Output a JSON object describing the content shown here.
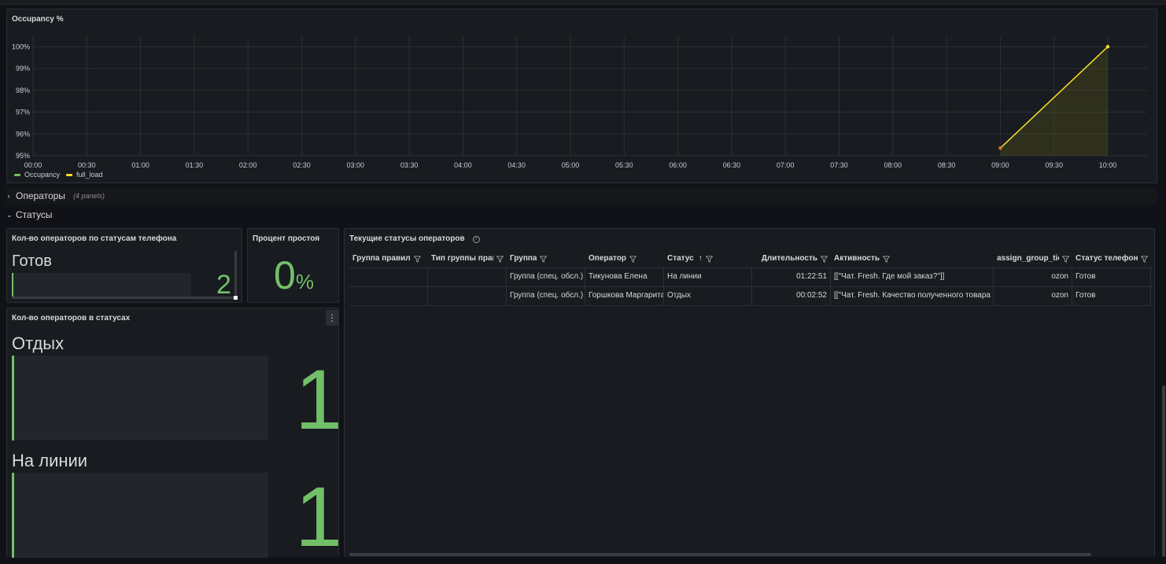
{
  "chart_panel": {
    "title": "Occupancy %",
    "legend": [
      {
        "name": "Occupancy",
        "color": "#73bf69"
      },
      {
        "name": "full_load",
        "color": "#fade2a"
      }
    ]
  },
  "chart_data": {
    "type": "line",
    "title": "Occupancy %",
    "x": [
      "00:00",
      "00:30",
      "01:00",
      "01:30",
      "02:00",
      "02:30",
      "03:00",
      "03:30",
      "04:00",
      "04:30",
      "05:00",
      "05:30",
      "06:00",
      "06:30",
      "07:00",
      "07:30",
      "08:00",
      "08:30",
      "09:00",
      "09:30",
      "10:00"
    ],
    "y_ticks": [
      "95%",
      "96%",
      "97%",
      "98%",
      "99%",
      "100%"
    ],
    "ylim": [
      95,
      100.05
    ],
    "grid": true,
    "legend_placement": "bottom-left",
    "series": [
      {
        "name": "full_load",
        "color": "#fade2a",
        "points": [
          {
            "x": "09:00",
            "y": 95.35
          },
          {
            "x": "10:00",
            "y": 100
          }
        ]
      }
    ]
  },
  "rows": {
    "operators": {
      "title": "Операторы",
      "subtitle": "(4 panels)",
      "chevron": "›"
    },
    "statuses": {
      "title": "Статусы",
      "chevron": "⌄"
    }
  },
  "phone_panel": {
    "title": "Кол-во операторов по статусам телефона",
    "items": [
      {
        "label": "Готов",
        "value": "2",
        "fill": 0.01
      }
    ]
  },
  "idle_panel": {
    "title": "Процент простоя",
    "value": "0",
    "unit": "%"
  },
  "status_panel": {
    "title": "Кол-во операторов в статусах",
    "menu": "⋮",
    "items": [
      {
        "label": "Отдых",
        "value": "1",
        "fill": 0.01
      },
      {
        "label": "На линии",
        "value": "1",
        "fill": 0.01
      }
    ]
  },
  "table_panel": {
    "title": "Текущие статусы операторов",
    "info": "i",
    "columns": [
      {
        "label": "Группа правил",
        "filter": true
      },
      {
        "label": "Тип группы прав",
        "filter": true
      },
      {
        "label": "Группа",
        "filter": true
      },
      {
        "label": "Оператор",
        "filter": true
      },
      {
        "label": "Статус",
        "sort": "↑",
        "filter": true
      },
      {
        "label": "Длительность",
        "filter": true
      },
      {
        "label": "Активность",
        "filter": true
      },
      {
        "label": "assign_group_ticl",
        "filter": true
      },
      {
        "label": "Статус телефона",
        "filter": true
      }
    ],
    "rows": [
      [
        "",
        "",
        "Группа (спец. обсл.)",
        "Тикунова Елена",
        "На линии",
        "01:22:51",
        "[[\"Чат. Fresh. Где мой заказ?\"]]",
        "ozon",
        "Готов"
      ],
      [
        "",
        "",
        "Группа (спец. обсл.)",
        "Горшкова Маргарита",
        "Отдых",
        "00:02:52",
        "[[\"Чат. Fresh. Качество полученного товара",
        "ozon",
        "Готов"
      ]
    ]
  }
}
